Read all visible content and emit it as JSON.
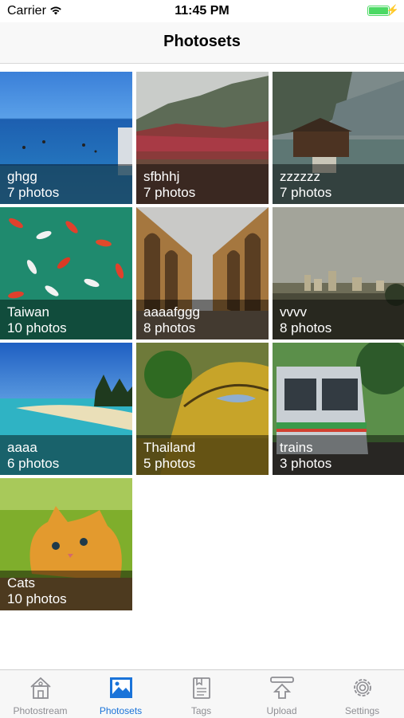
{
  "status_bar": {
    "carrier": "Carrier",
    "time": "11:45 PM",
    "battery_color": "#4cd964"
  },
  "nav": {
    "title": "Photosets"
  },
  "photosets": [
    {
      "name": "ghgg",
      "count": "7 photos",
      "image": "ocean-swimmers"
    },
    {
      "name": "sfbhhj",
      "count": "7 photos",
      "image": "misty-mountains"
    },
    {
      "name": "zzzzzz",
      "count": "7 photos",
      "image": "lake-boathouse"
    },
    {
      "name": "Taiwan",
      "count": "10 photos",
      "image": "koi-pond"
    },
    {
      "name": "aaaafggg",
      "count": "8 photos",
      "image": "arched-colonnade"
    },
    {
      "name": "vvvv",
      "count": "8 photos",
      "image": "hazy-skyline"
    },
    {
      "name": "aaaa",
      "count": "6 photos",
      "image": "tropical-beach"
    },
    {
      "name": "Thailand",
      "count": "5 photos",
      "image": "golden-dragon"
    },
    {
      "name": "trains",
      "count": "3 photos",
      "image": "commuter-train"
    },
    {
      "name": "Cats",
      "count": "10 photos",
      "image": "orange-kitten"
    }
  ],
  "tabs": [
    {
      "label": "Photostream",
      "icon": "house-icon",
      "active": false
    },
    {
      "label": "Photosets",
      "icon": "photo-icon",
      "active": true
    },
    {
      "label": "Tags",
      "icon": "tags-icon",
      "active": false
    },
    {
      "label": "Upload",
      "icon": "upload-icon",
      "active": false
    },
    {
      "label": "Settings",
      "icon": "gear-icon",
      "active": false
    }
  ],
  "colors": {
    "accent": "#1a73d9",
    "inactive_tab": "#8e8e93"
  }
}
